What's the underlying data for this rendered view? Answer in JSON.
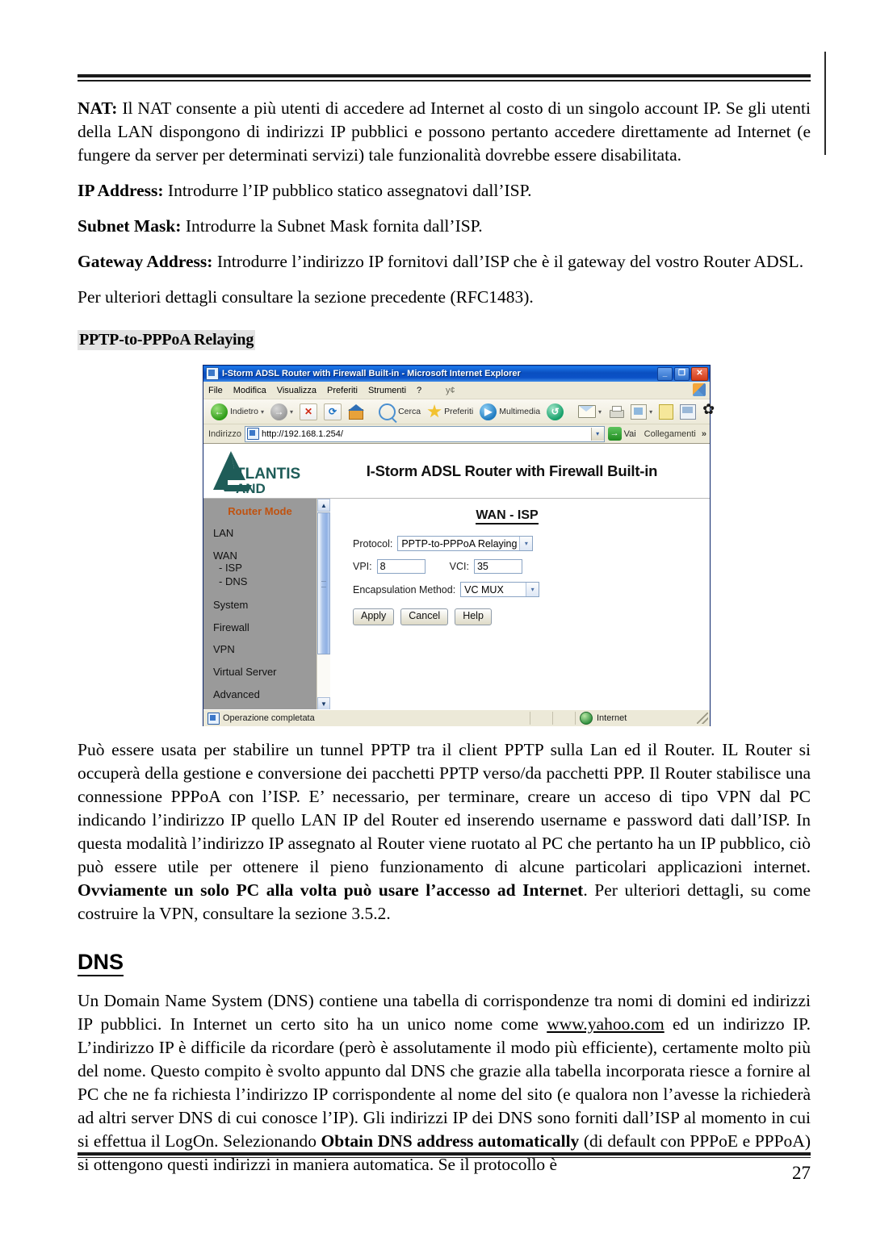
{
  "document": {
    "page_number": "27",
    "paragraphs": {
      "nat": {
        "label": "NAT:",
        "text": " Il NAT consente a più utenti di accedere ad Internet al costo di un singolo account IP. Se gli utenti della LAN dispongono di indirizzi IP pubblici e possono pertanto accedere direttamente ad Internet (e fungere da server per determinati servizi) tale funzionalità dovrebbe essere disabilitata."
      },
      "ip_address": {
        "label": "IP Address:",
        "text": " Introdurre l’IP pubblico statico assegnatovi dall’ISP."
      },
      "subnet_mask": {
        "label": "Subnet Mask:",
        "text": " Introdurre la Subnet Mask fornita dall’ISP."
      },
      "gateway_address": {
        "label": "Gateway Address:",
        "text": " Introdurre l’indirizzo IP fornitovi dall’ISP che è il gateway del vostro Router ADSL."
      },
      "rfc_note": "Per ulteriori dettagli consultare la sezione precedente (RFC1483).",
      "pptp_desc_1": "Può essere usata per stabilire un tunnel PPTP tra il client PPTP sulla Lan ed il Router. IL Router si occuperà  della gestione e conversione dei pacchetti PPTP verso/da pacchetti PPP. Il Router stabilisce una connessione PPPoA con l’ISP. E’ necessario, per terminare, creare un acceso di tipo VPN dal PC indicando l’indirizzo IP quello LAN IP del Router ed inserendo username e password dati dall’ISP. In questa modalità l’indirizzo IP assegnato al Router viene ruotato al PC che pertanto ha un IP pubblico, ciò può essere utile per ottenere il pieno funzionamento di alcune particolari applicazioni internet. ",
      "pptp_desc_bold": "Ovviamente un solo PC alla volta può usare l’accesso ad Internet",
      "pptp_desc_2": ". Per ulteriori dettagli, su come costruire la VPN, consultare la sezione 3.5.2.",
      "dns_desc_1": "Un Domain Name System (DNS) contiene una tabella di corrispondenze tra nomi di domini ed indirizzi IP pubblici. In Internet un certo sito ha un unico nome come ",
      "dns_link": "www.yahoo.com",
      "dns_desc_2": " ed un indirizzo IP.  L’indirizzo IP è difficile da ricordare (però è assolutamente il modo più efficiente), certamente molto più del nome. Questo compito è svolto appunto dal DNS che grazie alla tabella incorporata riesce a fornire al PC che ne fa richiesta l’indirizzo IP corrispondente al nome del sito (e qualora non l’avesse la richiederà ad altri server DNS di cui conosce l’IP). Gli indirizzi IP dei  DNS sono forniti dall’ISP al momento in cui si effettua il LogOn. Selezionando ",
      "dns_desc_bold": "Obtain DNS address automatically",
      "dns_desc_3": " (di default con PPPoE e PPPoA) si ottengono questi indirizzi in maniera automatica. Se il protocollo  è"
    },
    "headings": {
      "pptp_relaying": "PPTP-to-PPPoA Relaying",
      "dns": "DNS"
    }
  },
  "browser": {
    "title": "I-Storm ADSL Router with Firewall Built-in - Microsoft Internet Explorer",
    "window_buttons": {
      "minimize": "_",
      "restore": "❐",
      "close": "✕"
    },
    "menu": [
      "File",
      "Modifica",
      "Visualizza",
      "Preferiti",
      "Strumenti",
      "?"
    ],
    "menu_ghost": "y¢",
    "toolbar": {
      "back": "Indietro",
      "search": "Cerca",
      "favorites": "Preferiti",
      "media": "Multimedia",
      "dropdown_caret": "▾"
    },
    "address": {
      "label": "Indirizzo",
      "url": "http://192.168.1.254/",
      "go": "Vai",
      "links": "Collegamenti",
      "chevron": "»"
    },
    "status": {
      "text": "Operazione completata",
      "zone": "Internet"
    }
  },
  "router_page": {
    "logo": {
      "brand_top": "TLANTIS",
      "brand_bottom": "AND",
      "color": "#1e5c58"
    },
    "header_title": "I-Storm ADSL Router with Firewall Built-in",
    "section_title": "WAN - ISP",
    "menu": {
      "mode": "Router Mode",
      "mode_color": "#c0520f",
      "items": [
        {
          "label": "LAN",
          "type": "item"
        },
        {
          "label": "WAN",
          "type": "item"
        },
        {
          "label": "- ISP",
          "type": "sub"
        },
        {
          "label": "- DNS",
          "type": "sub"
        },
        {
          "label": "System",
          "type": "item"
        },
        {
          "label": "Firewall",
          "type": "item"
        },
        {
          "label": "VPN",
          "type": "item"
        },
        {
          "label": "Virtual Server",
          "type": "item"
        },
        {
          "label": "Advanced",
          "type": "item"
        }
      ]
    },
    "form": {
      "protocol_label": "Protocol:",
      "protocol_value": "PPTP-to-PPPoA Relaying",
      "vpi_label": "VPI:",
      "vpi_value": "8",
      "vci_label": "VCI:",
      "vci_value": "35",
      "encapsulation_label": "Encapsulation Method:",
      "encapsulation_value": "VC MUX",
      "buttons": {
        "apply": "Apply",
        "cancel": "Cancel",
        "help": "Help"
      }
    }
  }
}
